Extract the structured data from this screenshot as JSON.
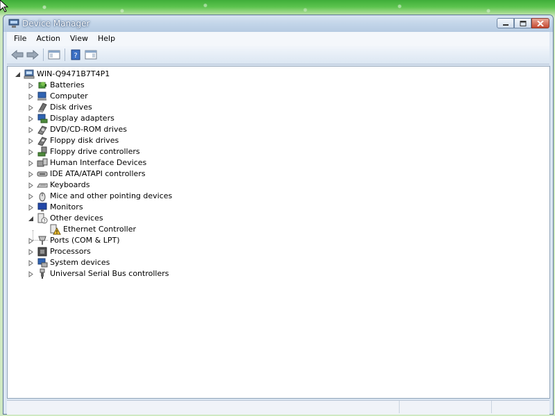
{
  "window": {
    "title": "Device Manager"
  },
  "menu": [
    "File",
    "Action",
    "View",
    "Help"
  ],
  "toolbar": {
    "buttons": [
      "back-icon",
      "forward-icon",
      "show-hide-console-tree-icon",
      "help-icon",
      "properties-pane-icon"
    ]
  },
  "tree": {
    "root": {
      "label": "WIN-Q9471B7T4P1",
      "icon": "computer-icon",
      "expanded": true
    },
    "categories": [
      {
        "label": "Batteries",
        "icon": "battery-icon",
        "expanded": false
      },
      {
        "label": "Computer",
        "icon": "computer-icon",
        "expanded": false
      },
      {
        "label": "Disk drives",
        "icon": "disk-drive-icon",
        "expanded": false
      },
      {
        "label": "Display adapters",
        "icon": "display-adapter-icon",
        "expanded": false
      },
      {
        "label": "DVD/CD-ROM drives",
        "icon": "dvd-icon",
        "expanded": false
      },
      {
        "label": "Floppy disk drives",
        "icon": "floppy-disk-icon",
        "expanded": false
      },
      {
        "label": "Floppy drive controllers",
        "icon": "floppy-controller-icon",
        "expanded": false
      },
      {
        "label": "Human Interface Devices",
        "icon": "hid-icon",
        "expanded": false
      },
      {
        "label": "IDE ATA/ATAPI controllers",
        "icon": "ide-controller-icon",
        "expanded": false
      },
      {
        "label": "Keyboards",
        "icon": "keyboard-icon",
        "expanded": false
      },
      {
        "label": "Mice and other pointing devices",
        "icon": "mouse-icon",
        "expanded": false
      },
      {
        "label": "Monitors",
        "icon": "monitor-icon",
        "expanded": false
      },
      {
        "label": "Other devices",
        "icon": "unknown-device-icon",
        "expanded": true,
        "children": [
          {
            "label": "Ethernet Controller",
            "icon": "warning-device-icon"
          }
        ]
      },
      {
        "label": "Ports (COM & LPT)",
        "icon": "port-icon",
        "expanded": false
      },
      {
        "label": "Processors",
        "icon": "processor-icon",
        "expanded": false
      },
      {
        "label": "System devices",
        "icon": "system-device-icon",
        "expanded": false
      },
      {
        "label": "Universal Serial Bus controllers",
        "icon": "usb-icon",
        "expanded": false
      }
    ]
  },
  "statusbar": {
    "panes": [
      "",
      "",
      ""
    ]
  },
  "colors": {
    "titlebar": "#c3d5e9",
    "close_button": "#c5472f",
    "warning": "#f2c230"
  }
}
